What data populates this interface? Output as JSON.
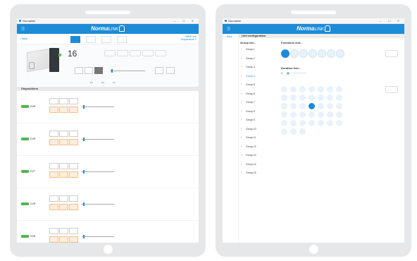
{
  "tablet1": {
    "window_title": "Normalink",
    "window_controls": "— ☐ ✕",
    "app_logo_main": "Norma",
    "app_logo_link": "LINK",
    "menu_icon": "menu-icon",
    "back_label": "‹ Back",
    "info_line1": "CBMS nnn",
    "info_line2": "Temperature X",
    "big_value": "16",
    "section_title": "Dispositions",
    "disposition_tags": [
      "DVR",
      "DVR",
      "DVT",
      "DVR",
      "DVR"
    ]
  },
  "tablet2": {
    "window_title": "Normalink",
    "window_controls": "— ☐ ✕",
    "app_logo_main": "Norma",
    "app_logo_link": "LINK",
    "back_label": "‹ Back",
    "header": "Unit configuration",
    "group_list_title": "Group list...",
    "functions_title": "Functions test...",
    "duration_title": "Duration test...",
    "groups": [
      "Group 1",
      "Group 2",
      "Group 3",
      "Group 4",
      "Group 5",
      "Group 6",
      "Group 7",
      "Group 8",
      "Group 9",
      "Group 10",
      "Group 11",
      "Group 12",
      "Group 13",
      "Group 14",
      "Group 15"
    ],
    "active_group_index": 3
  },
  "colors": {
    "accent": "#1e8bd6",
    "tablet_frame": "#e6e7e9",
    "status_green": "#52b552",
    "orange_button": "#fdeedd"
  }
}
